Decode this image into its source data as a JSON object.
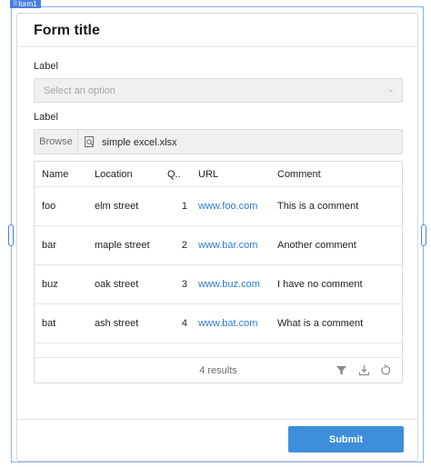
{
  "selection": {
    "tag": "form1"
  },
  "form": {
    "title": "Form title",
    "select_label": "Label",
    "select_placeholder": "Select an option",
    "file_label": "Label",
    "browse_label": "Browse",
    "file_name": "simple excel.xlsx"
  },
  "table": {
    "columns": [
      "Name",
      "Location",
      "Q..",
      "URL",
      "Comment"
    ],
    "rows": [
      {
        "name": "foo",
        "location": "elm street",
        "qty": "1",
        "url": "www.foo.com",
        "comment": "This is a comment"
      },
      {
        "name": "bar",
        "location": "maple street",
        "qty": "2",
        "url": "www.bar.com",
        "comment": "Another comment"
      },
      {
        "name": "buz",
        "location": "oak street",
        "qty": "3",
        "url": "www.buz.com",
        "comment": "I have no comment"
      },
      {
        "name": "bat",
        "location": "ash street",
        "qty": "4",
        "url": "www.bat.com",
        "comment": "What is a comment"
      }
    ],
    "results": "4 results",
    "icons": [
      "filter-icon",
      "download-icon",
      "refresh-icon"
    ]
  },
  "submit_label": "Submit",
  "colors": {
    "accent": "#3d8fdb",
    "link": "#2b7bd9",
    "selection": "#4a7fe0"
  }
}
